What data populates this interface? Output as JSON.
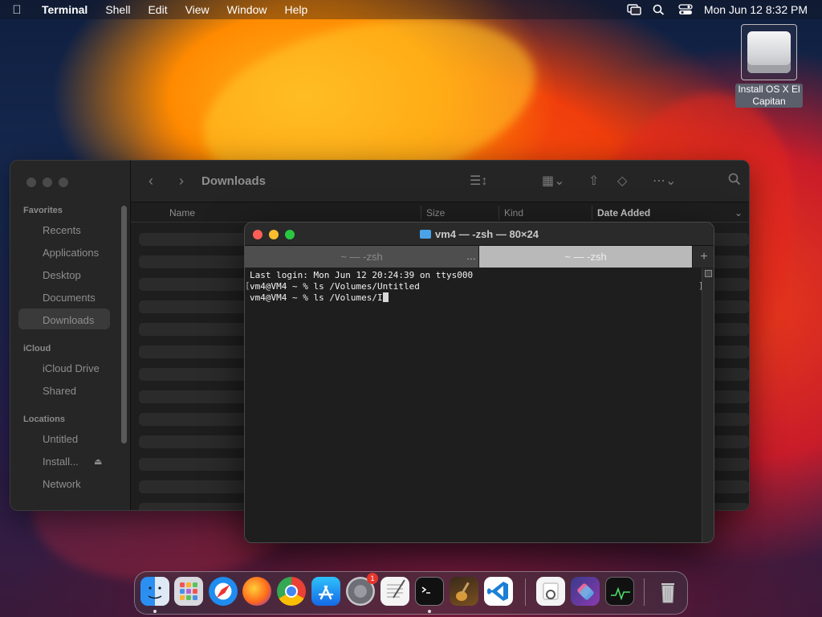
{
  "menubar": {
    "app_name": "Terminal",
    "items": [
      "Shell",
      "Edit",
      "View",
      "Window",
      "Help"
    ],
    "clock": "Mon Jun 12  8:32 PM"
  },
  "desktop": {
    "disk_label_line1": "Install OS X El",
    "disk_label_line2": "Capitan"
  },
  "finder": {
    "title": "Downloads",
    "sidebar": {
      "favorites_header": "Favorites",
      "favorites": [
        "Recents",
        "Applications",
        "Desktop",
        "Documents",
        "Downloads"
      ],
      "icloud_header": "iCloud",
      "icloud": [
        "iCloud Drive",
        "Shared"
      ],
      "locations_header": "Locations",
      "locations": [
        "Untitled",
        "Install...",
        "Network"
      ]
    },
    "columns": {
      "name": "Name",
      "size": "Size",
      "kind": "Kind",
      "date_added": "Date Added"
    }
  },
  "terminal": {
    "title": "vm4 — -zsh — 80×24",
    "tabs": [
      {
        "label": "~ — -zsh"
      },
      {
        "label": "~ — -zsh"
      }
    ],
    "lines": [
      "Last login: Mon Jun 12 20:24:39 on ttys000",
      "vm4@VM4 ~ % ls /Volumes/Untitled",
      "vm4@VM4 ~ % ls /Volumes/I"
    ]
  },
  "dock": {
    "apps": [
      "Finder",
      "Launchpad",
      "Safari",
      "Firefox",
      "Chrome",
      "App Store",
      "System Settings",
      "TextEdit",
      "Terminal",
      "Instruments",
      "Visual Studio Code",
      "Preview",
      "Shortcuts",
      "Activity Monitor",
      "Trash"
    ],
    "settings_badge": "1"
  },
  "colors": {
    "close": "#ff5f57",
    "minimize": "#febc2e",
    "zoom": "#28c840"
  }
}
